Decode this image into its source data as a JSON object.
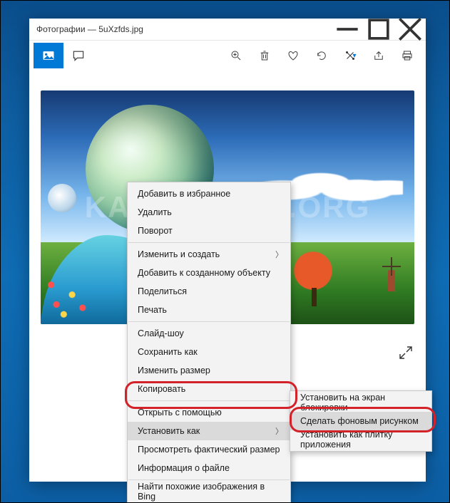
{
  "window": {
    "title": "Фотографии — 5uXzfds.jpg"
  },
  "watermark": "KAK-SDELAT.ORG",
  "toolbar": {
    "view_tab": "Просмотр",
    "comment_tab": "Комментарий",
    "zoom": "Лупа",
    "delete": "Удалить",
    "favorite": "Избранное",
    "rotate": "Повернуть",
    "edit": "Изменить",
    "share": "Поделиться",
    "print": "Печать"
  },
  "context_menu": {
    "items": [
      {
        "label": "Добавить в избранное",
        "sub": false
      },
      {
        "label": "Удалить",
        "sub": false
      },
      {
        "label": "Поворот",
        "sub": false
      },
      {
        "label": "Изменить и создать",
        "sub": true
      },
      {
        "label": "Добавить к созданному объекту",
        "sub": false
      },
      {
        "label": "Поделиться",
        "sub": false
      },
      {
        "label": "Печать",
        "sub": false
      },
      {
        "label": "Слайд-шоу",
        "sub": false
      },
      {
        "label": "Сохранить как",
        "sub": false
      },
      {
        "label": "Изменить размер",
        "sub": false
      },
      {
        "label": "Копировать",
        "sub": false
      },
      {
        "label": "Открыть с помощью",
        "sub": false
      },
      {
        "label": "Установить как",
        "sub": true
      },
      {
        "label": "Просмотреть фактический размер",
        "sub": false
      },
      {
        "label": "Информация о файле",
        "sub": false
      },
      {
        "label": "Найти похожие изображения в Bing",
        "sub": false
      }
    ]
  },
  "submenu": {
    "items": [
      {
        "label": "Установить на экран блокировки"
      },
      {
        "label": "Сделать фоновым рисунком"
      },
      {
        "label": "Установить как плитку приложения"
      }
    ]
  }
}
